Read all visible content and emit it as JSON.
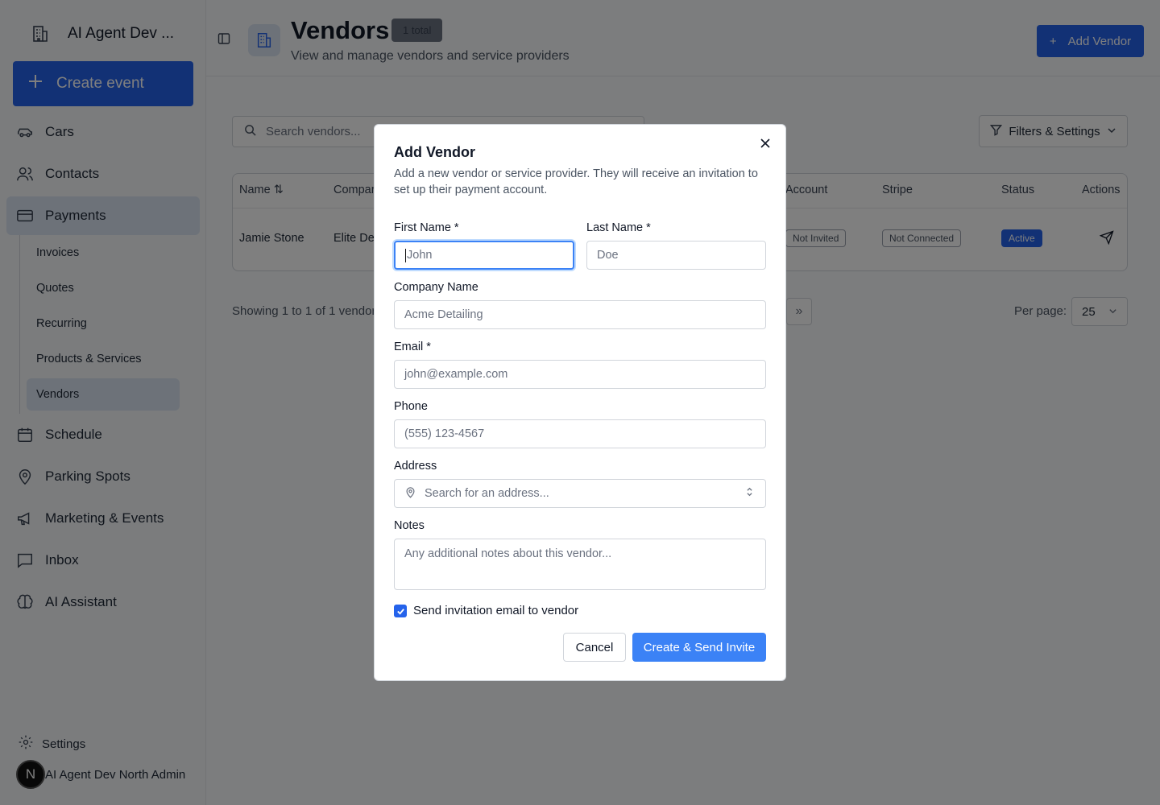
{
  "sidebar": {
    "brand": "AI Agent Dev ...",
    "create_event": "Create event",
    "items": [
      {
        "label": "Cars",
        "icon": "car-icon"
      },
      {
        "label": "Contacts",
        "icon": "users-icon"
      },
      {
        "label": "Payments",
        "icon": "credit-card-icon"
      },
      {
        "label": "Schedule",
        "icon": "calendar-icon"
      },
      {
        "label": "Parking Spots",
        "icon": "map-pin-icon"
      },
      {
        "label": "Marketing & Events",
        "icon": "megaphone-icon"
      },
      {
        "label": "Inbox",
        "icon": "message-icon"
      },
      {
        "label": "AI Assistant",
        "icon": "brain-icon"
      }
    ],
    "payments_sub": [
      "Invoices",
      "Quotes",
      "Recurring",
      "Products & Services",
      "Vendors"
    ],
    "settings": "Settings",
    "user_initial": "N",
    "user_name": "AI Agent Dev North Admin"
  },
  "header": {
    "title": "Vendors",
    "count_badge": "1 total",
    "subtitle": "View and manage vendors and service providers",
    "add_button": "Add Vendor"
  },
  "toolbar": {
    "search_placeholder": "Search vendors...",
    "filters_label": "Filters & Settings"
  },
  "table": {
    "headers": [
      "Name",
      "Compar",
      "Account",
      "Stripe",
      "Status",
      "Actions"
    ],
    "row": {
      "name": "Jamie Stone",
      "company": "Elite De",
      "account": "Not Invited",
      "stripe": "Not Connected",
      "status": "Active"
    }
  },
  "pagination": {
    "showing": "Showing 1 to 1 of 1 vendor",
    "last_page": "»",
    "per_page_label": "Per page:",
    "per_page_value": "25"
  },
  "modal": {
    "title": "Add Vendor",
    "description": "Add a new vendor or service provider. They will receive an invitation to set up their payment account.",
    "first_name_label": "First Name *",
    "first_name_placeholder": "John",
    "last_name_label": "Last Name *",
    "last_name_placeholder": "Doe",
    "company_label": "Company Name",
    "company_placeholder": "Acme Detailing",
    "email_label": "Email *",
    "email_placeholder": "john@example.com",
    "phone_label": "Phone",
    "phone_placeholder": "(555) 123-4567",
    "address_label": "Address",
    "address_placeholder": "Search for an address...",
    "notes_label": "Notes",
    "notes_placeholder": "Any additional notes about this vendor...",
    "send_invite_label": "Send invitation email to vendor",
    "send_invite_checked": true,
    "cancel": "Cancel",
    "create": "Create & Send Invite"
  },
  "colors": {
    "accent": "#2563eb",
    "overlay": "rgba(0,0,0,0.5)"
  }
}
